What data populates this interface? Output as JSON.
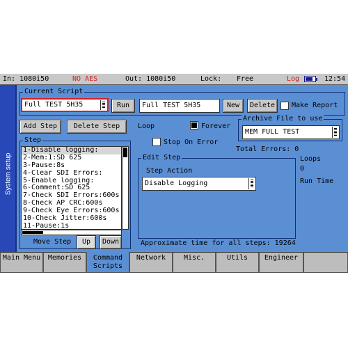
{
  "status": {
    "input": "In: 1080i50",
    "audio": "NO AES",
    "output": "Out: 1080i50",
    "lock_label": "Lock:",
    "lock_value": "Free",
    "log": "Log",
    "battery_level": 0.75,
    "time": "12:54"
  },
  "side_tab": "System setup",
  "current_script": {
    "legend": "Current Script",
    "script_value": "Full TEST 5H35",
    "run_label": "Run",
    "name_value": "Full TEST 5H35",
    "new_label": "New",
    "delete_label": "Delete",
    "make_report_label": "Make Report"
  },
  "toolbar": {
    "add_step_label": "Add Step",
    "delete_step_label": "Delete Step"
  },
  "loop": {
    "loop_label": "Loop",
    "forever_label": "Forever",
    "stop_on_error_label": "Stop On Error",
    "total_errors": "Total Errors: 0",
    "loops_label": "Loops",
    "loops_value": "0",
    "run_time_label": "Run Time"
  },
  "archive": {
    "legend": "Archive File to use",
    "value": "MEM FULL TEST"
  },
  "step": {
    "legend": "Step",
    "items": [
      "1-Disable logging:",
      "2-Mem:1:SD 625",
      "3-Pause:8s",
      "4-Clear SDI Errors:",
      "5-Enable logging:",
      "6-Comment:SD 625",
      "7-Check SDI Errors:600s",
      "8-Check AP CRC:600s",
      "9-Check Eye Errors:600s",
      "10-Check Jitter:600s",
      "11-Pause:1s"
    ],
    "move_step_label": "Move Step",
    "up_label": "Up",
    "down_label": "Down"
  },
  "edit_step": {
    "legend": "Edit Step",
    "action_label": "Step Action",
    "action_value": "Disable Logging"
  },
  "approx_time": "Approximate time for all steps: 19264",
  "tabs": [
    "Main Menu",
    "Memories",
    "Command\nScripts",
    "Network",
    "Misc.",
    "Utils",
    "Engineer",
    ""
  ]
}
